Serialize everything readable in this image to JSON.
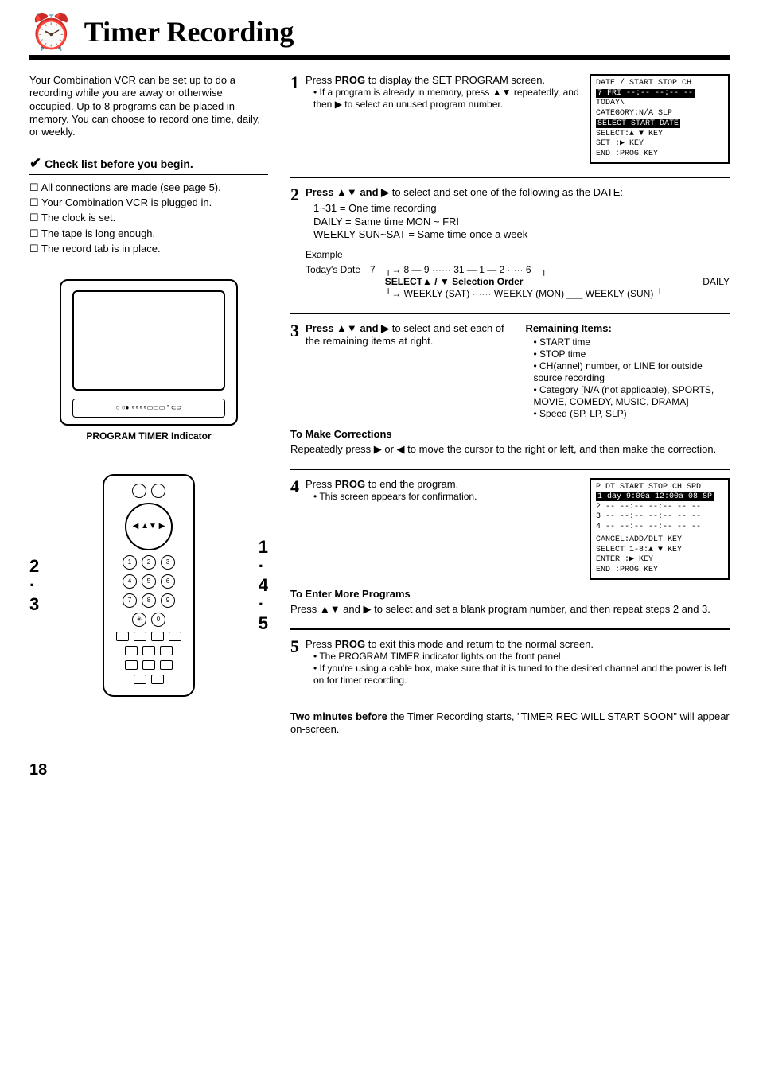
{
  "title": "Timer Recording",
  "intro": "Your Combination VCR can be set up to do a recording while you are away or otherwise occupied. Up to 8 programs can be placed in memory. You can choose to record one time, daily, or weekly.",
  "checklist_title": "Check list before you begin.",
  "checklist": [
    "All connections are made (see page 5).",
    "Your Combination VCR is plugged in.",
    "The clock is set.",
    "The tape is long enough.",
    "The record tab is in place."
  ],
  "tv_caption": "PROGRAM TIMER Indicator",
  "remote_left": "2\n·\n3",
  "remote_right": "1\n·\n4\n·\n5",
  "steps": {
    "s1": {
      "num": "1",
      "title_a": "Press ",
      "title_b": "PROG",
      "title_c": " to display the SET PROGRAM screen.",
      "bullet": "If a program is already in memory, press ▲▼ repeatedly, and then ▶ to select an unused program number."
    },
    "s2": {
      "num": "2",
      "title": "Press ▲▼ and ▶ to select and set one of the following as the DATE:",
      "lines": [
        "1~31 = One time recording",
        "DAILY = Same time MON ~ FRI",
        "WEEKLY SUN~SAT = Same time once a week"
      ],
      "example_label": "Example",
      "today_label": "Today's Date",
      "seq": "8 — 9 ······ 31 — 1 — 2 ····· 6",
      "select_label": "SELECT▲ / ▼ Selection Order",
      "daily": "DAILY",
      "weekly": "WEEKLY (SAT) ······ WEEKLY (MON) ___ WEEKLY (SUN)",
      "seven": "7"
    },
    "s3": {
      "num": "3",
      "title": "Press ▲▼ and ▶ to select and set each of the remaining items at right.",
      "remaining_title": "Remaining Items:",
      "remaining": [
        "START time",
        "STOP time",
        "CH(annel) number, or LINE for outside source recording",
        "Category [N/A (not applicable), SPORTS, MOVIE, COMEDY, MUSIC, DRAMA]",
        "Speed (SP, LP, SLP)"
      ],
      "corr_title": "To Make Corrections",
      "corr": "Repeatedly press ▶ or ◀ to move the cursor to the right or left, and then make the correction."
    },
    "s4": {
      "num": "4",
      "title_a": "Press ",
      "title_b": "PROG",
      "title_c": " to end the program.",
      "bullet": "This screen appears for confirmation.",
      "more_title": "To Enter More Programs",
      "more": "Press ▲▼ and ▶ to select and set a blank program number, and then repeat steps 2 and 3."
    },
    "s5": {
      "num": "5",
      "title_a": "Press ",
      "title_b": "PROG",
      "title_c": " to exit this mode and return to the normal screen.",
      "bullets": [
        "The PROGRAM TIMER indicator lights on the front panel.",
        "If you're using a cable box, make sure that it is tuned to the desired channel and the power is left on for timer recording."
      ]
    }
  },
  "osd1": {
    "l1": "DATE / START   STOP   CH",
    "l2": " 7 FRI  --:--   --:-- --",
    "l3": "TODAY\\",
    "l4": "CATEGORY:N/A        SLP",
    "l5": "SELECT START DATE",
    "l6": " SELECT:▲ ▼ KEY",
    "l7": " SET   :▶ KEY",
    "l8": " END   :PROG KEY"
  },
  "osd2": {
    "l1": "P DT START  STOP  CH SPD",
    "l2": "1 day 9:00a 12:00a 08 SP",
    "l3": "2 -- --:-- --:-- -- --",
    "l4": "3 -- --:-- --:-- -- --",
    "l5": "4 -- --:-- --:-- -- --",
    "l6": "CANCEL:ADD/DLT KEY",
    "l7": "SELECT 1-8:▲ ▼ KEY",
    "l8": "ENTER :▶ KEY",
    "l9": "END   :PROG KEY"
  },
  "footer_a": "Two minutes before",
  "footer_b": " the Timer Recording starts, \"TIMER REC WILL START SOON\" will appear on-screen.",
  "page": "18"
}
